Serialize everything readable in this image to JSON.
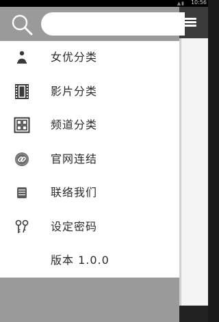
{
  "status_bar": {
    "time": "10:56",
    "icons": "signal-icon battery-icon"
  },
  "search": {
    "placeholder": ""
  },
  "menu": [
    {
      "id": "actress",
      "label": "女优分类",
      "icon": "person-icon"
    },
    {
      "id": "film",
      "label": "影片分类",
      "icon": "film-strip-icon"
    },
    {
      "id": "channel",
      "label": "频道分类",
      "icon": "grid-icon"
    },
    {
      "id": "website",
      "label": "官网连结",
      "icon": "link-icon"
    },
    {
      "id": "contact",
      "label": "联络我们",
      "icon": "message-icon"
    },
    {
      "id": "password",
      "label": "设定密码",
      "icon": "keys-icon"
    },
    {
      "id": "version",
      "label": "版本 1.0.0",
      "icon": ""
    }
  ],
  "colors": {
    "header": "#9a9a9a",
    "drawer_bg": "#ffffff",
    "app_header": "#3b3b3b",
    "text": "#2a2a2a"
  }
}
